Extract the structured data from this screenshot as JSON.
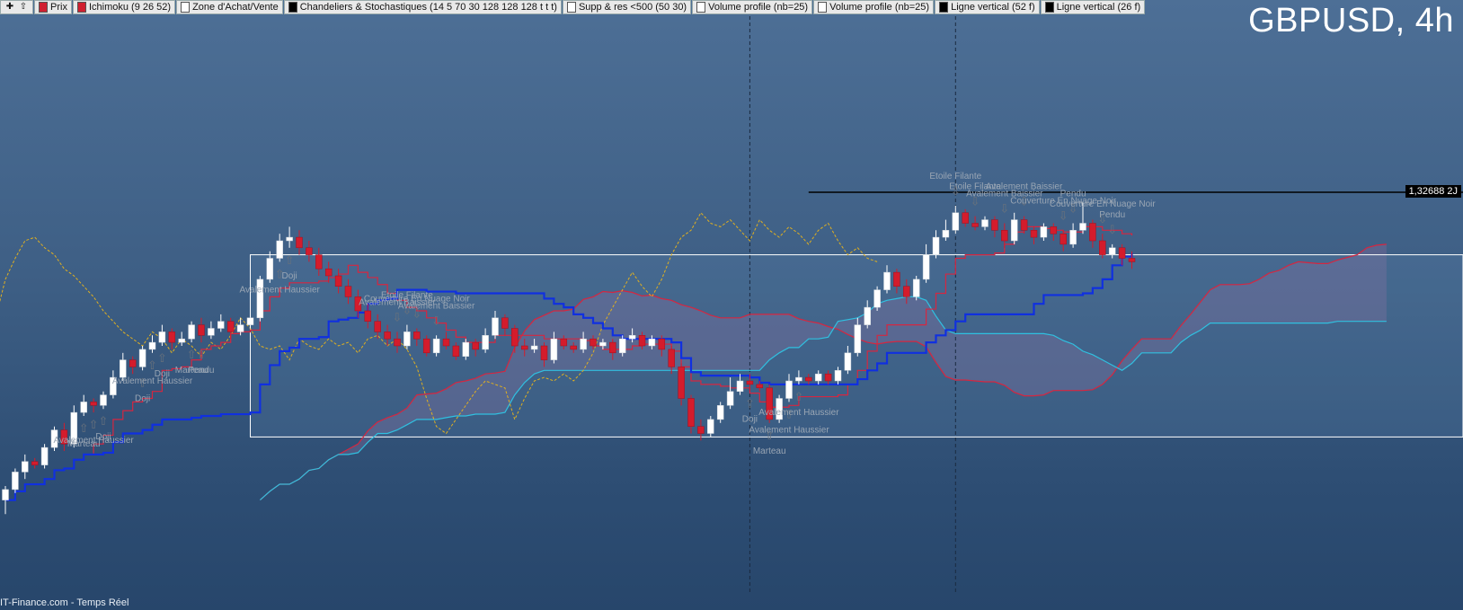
{
  "toolbar": [
    {
      "label": "Prix",
      "color": "#d02030"
    },
    {
      "label": "Ichimoku (9 26 52)",
      "color": "#d02030"
    },
    {
      "label": "Zone d'Achat/Vente",
      "color": "#ffffff"
    },
    {
      "label": "Chandeliers & Stochastiques (14 5 70 30 128 128 128 t t t)",
      "color": "#000000"
    },
    {
      "label": "Supp & res <500 (50 30)",
      "color": "#ffffff"
    },
    {
      "label": "Volume profile (nb=25)",
      "color": "#ffffff"
    },
    {
      "label": "Volume profile (nb=25)",
      "color": "#ffffff"
    },
    {
      "label": "Ligne vertical (52 f)",
      "color": "#000000"
    },
    {
      "label": "Ligne vertical (26 f)",
      "color": "#000000"
    }
  ],
  "title": "GBPUSD, 4h",
  "footer": "IT-Finance.com - Temps Réel",
  "price_tag": "1,32688 2J",
  "colors": {
    "bull": "#ffffff",
    "bear": "#d41c2c",
    "kijun": "#1030e0",
    "tenkan": "#d62640",
    "chikou": "#e0b020",
    "ssa": "#d62640",
    "ssb": "#30c0e0"
  },
  "chart_data": {
    "type": "candlestick",
    "symbol": "GBPUSD",
    "timeframe": "4h",
    "price_level": 1.32688,
    "indicator": "Ichimoku (9 26 52)",
    "candles": [
      [
        0.6,
        0.9,
        0.2,
        1.0
      ],
      [
        0.9,
        1.4,
        0.8,
        1.5
      ],
      [
        1.4,
        1.7,
        1.2,
        1.9
      ],
      [
        1.7,
        1.6,
        1.5,
        1.8
      ],
      [
        1.6,
        2.1,
        1.5,
        2.2
      ],
      [
        2.1,
        2.6,
        2.0,
        2.7
      ],
      [
        2.6,
        2.2,
        2.0,
        2.8
      ],
      [
        2.2,
        3.1,
        2.1,
        3.3
      ],
      [
        3.1,
        3.4,
        3.0,
        3.6
      ],
      [
        3.4,
        3.3,
        3.1,
        3.5
      ],
      [
        3.3,
        3.6,
        3.2,
        3.7
      ],
      [
        3.6,
        4.1,
        3.5,
        4.3
      ],
      [
        4.1,
        4.6,
        4.0,
        4.8
      ],
      [
        4.6,
        4.4,
        4.2,
        4.7
      ],
      [
        4.4,
        4.9,
        4.3,
        5.0
      ],
      [
        4.9,
        5.1,
        4.8,
        5.3
      ],
      [
        5.1,
        5.4,
        5.0,
        5.6
      ],
      [
        5.4,
        5.1,
        4.9,
        5.5
      ],
      [
        5.1,
        5.2,
        5.0,
        5.4
      ],
      [
        5.2,
        5.6,
        5.1,
        5.7
      ],
      [
        5.6,
        5.3,
        5.1,
        5.8
      ],
      [
        5.3,
        5.5,
        5.2,
        5.7
      ],
      [
        5.5,
        5.7,
        5.4,
        5.9
      ],
      [
        5.7,
        5.4,
        5.2,
        5.8
      ],
      [
        5.4,
        5.6,
        5.3,
        5.8
      ],
      [
        5.6,
        5.8,
        5.5,
        6.0
      ],
      [
        5.8,
        6.9,
        5.7,
        7.0
      ],
      [
        6.9,
        7.5,
        6.8,
        7.7
      ],
      [
        7.5,
        8.0,
        7.4,
        8.2
      ],
      [
        8.0,
        8.1,
        7.8,
        8.4
      ],
      [
        8.1,
        7.8,
        7.6,
        8.3
      ],
      [
        7.8,
        7.6,
        7.4,
        8.0
      ],
      [
        7.6,
        7.2,
        7.0,
        7.8
      ],
      [
        7.2,
        7.0,
        6.8,
        7.4
      ],
      [
        7.0,
        6.7,
        6.5,
        7.2
      ],
      [
        6.7,
        6.4,
        6.2,
        6.9
      ],
      [
        6.4,
        6.0,
        5.8,
        6.6
      ],
      [
        6.0,
        5.7,
        5.5,
        6.2
      ],
      [
        5.7,
        5.4,
        5.2,
        5.9
      ],
      [
        5.4,
        5.2,
        5.0,
        5.6
      ],
      [
        5.2,
        5.0,
        4.8,
        5.4
      ],
      [
        5.0,
        5.4,
        4.9,
        5.6
      ],
      [
        5.4,
        5.2,
        5.0,
        5.5
      ],
      [
        5.2,
        4.8,
        4.7,
        5.3
      ],
      [
        4.8,
        5.2,
        4.7,
        5.3
      ],
      [
        5.2,
        5.0,
        4.9,
        5.4
      ],
      [
        5.0,
        4.7,
        4.6,
        5.1
      ],
      [
        4.7,
        5.1,
        4.6,
        5.2
      ],
      [
        5.1,
        4.9,
        4.7,
        5.2
      ],
      [
        4.9,
        5.3,
        4.8,
        5.5
      ],
      [
        5.3,
        5.8,
        5.2,
        6.0
      ],
      [
        5.8,
        5.5,
        5.3,
        5.9
      ],
      [
        5.5,
        5.0,
        4.8,
        5.6
      ],
      [
        5.0,
        4.9,
        4.7,
        5.2
      ],
      [
        4.9,
        5.0,
        4.8,
        5.2
      ],
      [
        5.0,
        4.6,
        4.4,
        5.1
      ],
      [
        4.6,
        5.2,
        4.5,
        5.4
      ],
      [
        5.2,
        5.0,
        4.9,
        5.3
      ],
      [
        5.0,
        4.9,
        4.8,
        5.1
      ],
      [
        4.9,
        5.2,
        4.8,
        5.4
      ],
      [
        5.2,
        5.0,
        4.9,
        5.3
      ],
      [
        5.0,
        5.1,
        4.9,
        5.2
      ],
      [
        5.1,
        4.8,
        4.6,
        5.2
      ],
      [
        4.8,
        5.2,
        4.7,
        5.3
      ],
      [
        5.2,
        5.3,
        5.1,
        5.5
      ],
      [
        5.3,
        5.0,
        4.9,
        5.4
      ],
      [
        5.0,
        5.2,
        4.9,
        5.3
      ],
      [
        5.2,
        4.9,
        4.7,
        5.3
      ],
      [
        4.9,
        4.4,
        4.2,
        5.0
      ],
      [
        4.4,
        3.5,
        3.3,
        4.5
      ],
      [
        3.5,
        2.7,
        2.5,
        3.6
      ],
      [
        2.7,
        2.5,
        2.3,
        2.9
      ],
      [
        2.5,
        2.9,
        2.4,
        3.0
      ],
      [
        2.9,
        3.3,
        2.8,
        3.4
      ],
      [
        3.3,
        3.7,
        3.2,
        4.1
      ],
      [
        3.7,
        4.0,
        3.6,
        4.2
      ],
      [
        4.0,
        3.9,
        3.7,
        4.2
      ],
      [
        3.9,
        3.8,
        3.7,
        4.0
      ],
      [
        3.8,
        2.9,
        2.8,
        3.9
      ],
      [
        2.9,
        3.5,
        2.8,
        3.6
      ],
      [
        3.5,
        4.0,
        3.4,
        4.2
      ],
      [
        4.0,
        4.1,
        3.9,
        4.3
      ],
      [
        4.1,
        4.0,
        3.9,
        4.2
      ],
      [
        4.0,
        4.2,
        3.9,
        4.3
      ],
      [
        4.2,
        4.0,
        3.9,
        4.3
      ],
      [
        4.0,
        4.3,
        3.9,
        4.4
      ],
      [
        4.3,
        4.8,
        4.2,
        5.0
      ],
      [
        4.8,
        5.6,
        4.7,
        5.8
      ],
      [
        5.6,
        6.1,
        5.5,
        6.3
      ],
      [
        6.1,
        6.6,
        6.0,
        6.7
      ],
      [
        6.6,
        7.1,
        6.5,
        7.3
      ],
      [
        7.1,
        6.7,
        6.5,
        7.2
      ],
      [
        6.7,
        6.4,
        6.2,
        6.9
      ],
      [
        6.4,
        6.9,
        6.3,
        7.0
      ],
      [
        6.9,
        7.6,
        6.8,
        7.9
      ],
      [
        7.6,
        8.1,
        7.5,
        8.3
      ],
      [
        8.1,
        8.3,
        8.0,
        8.6
      ],
      [
        8.3,
        8.8,
        8.2,
        9.0
      ],
      [
        8.8,
        8.5,
        8.4,
        8.9
      ],
      [
        8.5,
        8.4,
        8.3,
        8.7
      ],
      [
        8.4,
        8.6,
        8.3,
        8.7
      ],
      [
        8.6,
        8.3,
        8.1,
        8.7
      ],
      [
        8.3,
        8.0,
        7.8,
        8.5
      ],
      [
        8.0,
        8.6,
        7.9,
        8.8
      ],
      [
        8.6,
        8.3,
        8.2,
        8.7
      ],
      [
        8.3,
        8.1,
        7.9,
        8.4
      ],
      [
        8.1,
        8.4,
        8.0,
        8.5
      ],
      [
        8.4,
        8.2,
        8.0,
        8.5
      ],
      [
        8.2,
        7.9,
        7.7,
        8.3
      ],
      [
        7.9,
        8.3,
        7.8,
        8.5
      ],
      [
        8.3,
        8.5,
        8.2,
        9.1
      ],
      [
        8.5,
        8.0,
        7.8,
        8.6
      ],
      [
        8.0,
        7.6,
        7.5,
        8.2
      ],
      [
        7.6,
        7.8,
        7.5,
        7.9
      ],
      [
        7.8,
        7.5,
        7.3,
        7.9
      ],
      [
        7.5,
        7.4,
        7.2,
        7.7
      ]
    ],
    "patterns": [
      {
        "label": "Marteau",
        "arrow": "up"
      },
      {
        "label": "Avalement Haussier",
        "arrow": "up"
      },
      {
        "label": "Doji",
        "arrow": "up"
      },
      {
        "label": "Doji",
        "arrow": "up"
      },
      {
        "label": "Avalement Haussier",
        "arrow": "up"
      },
      {
        "label": "Doji",
        "arrow": "up"
      },
      {
        "label": "Marteau",
        "arrow": "up"
      },
      {
        "label": "Pendu",
        "arrow": "up"
      },
      {
        "label": "Avalement Haussier",
        "arrow": "up"
      },
      {
        "label": "Doji",
        "arrow": "up"
      },
      {
        "label": "Etoile Filante",
        "arrow": "down"
      },
      {
        "label": "Avalement Baissier",
        "arrow": "down"
      },
      {
        "label": "Avalement Baissier",
        "arrow": "down"
      },
      {
        "label": "Couverture En Nuage Noir",
        "arrow": "down"
      },
      {
        "label": "Doji",
        "arrow": "up"
      },
      {
        "label": "Marteau",
        "arrow": "up"
      },
      {
        "label": "Avalement Haussier",
        "arrow": "up"
      },
      {
        "label": "Avalement Haussier",
        "arrow": "up"
      },
      {
        "label": "Etoile Filante",
        "arrow": "down"
      },
      {
        "label": "Etoile Filante",
        "arrow": "down"
      },
      {
        "label": "Avalement Baissier",
        "arrow": "down"
      },
      {
        "label": "Avalement Baissier",
        "arrow": "down"
      },
      {
        "label": "Couverture En Nuage Noir",
        "arrow": "down"
      },
      {
        "label": "Pendu",
        "arrow": "down"
      },
      {
        "label": "Couverture En Nuage Noir",
        "arrow": "down"
      },
      {
        "label": "Pendu",
        "arrow": "down"
      }
    ]
  }
}
